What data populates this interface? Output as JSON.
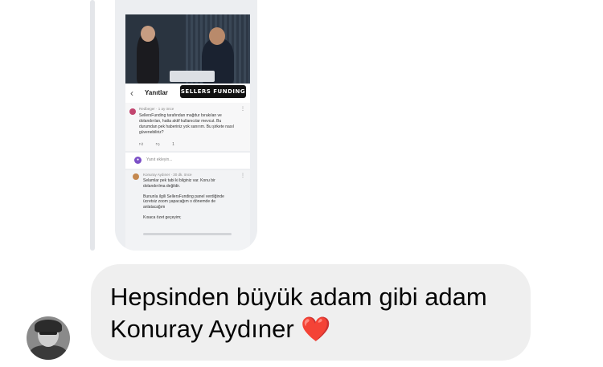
{
  "shared_screenshot": {
    "brand_badge": "SELLERS FUNDING",
    "header_title": "Yanıtlar",
    "comment1": {
      "meta": "Redbeger · 1 ay önce",
      "text": "SellersFunding tarafından mağdur bırakılan ve\ndolandırılan, hatta aktif kullanıcılar mevcut. Bu\ndurumdan pek haberiniz yok sanırım. Bu şirkete nasıl\ngüvenebiliriz?",
      "reply_count": "1"
    },
    "reply_placeholder": "Yanıt ekleyin...",
    "comment2": {
      "meta": "Konuray Aydıner · 30 dk. önce",
      "text": "Selamlar pek tabi ki bilginiz var. Konu bir\ndolandırılma değildir.\n\nBununla ilgili SellersFunding panel verdiğinde\nücretsiz zoom yapacağım o dönemde de\nanlatacağım\n\nKısaca özet geçeyim;"
    }
  },
  "message": {
    "line1": "Hepsinden büyük adam gibi adam",
    "line2": "Konuray Aydıner",
    "emoji": "❤️"
  },
  "colors": {
    "bubble": "#efefef",
    "heart": "#e0231f",
    "text": "#050505"
  }
}
